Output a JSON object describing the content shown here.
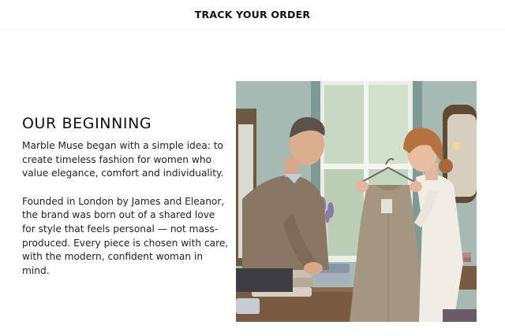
{
  "header": {
    "track_order": "TRACK YOUR ORDER"
  },
  "about": {
    "heading": "OUR BEGINNING",
    "paragraph_1": "Marble Muse began with a simple idea: to create timeless fashion for women who value elegance, comfort and individuality.",
    "paragraph_2": "Founded in London by James and Eleanor, the brand was born out of a shared love for style that feels personal — not mass-produced. Every piece is chosen with care, with the modern, confident woman in mind."
  },
  "colors": {
    "wall": "#9fb3ad",
    "sweater": "#8a7763",
    "dress": "#a59682",
    "blouse": "#f1ede6",
    "table": "#7a5a40"
  }
}
